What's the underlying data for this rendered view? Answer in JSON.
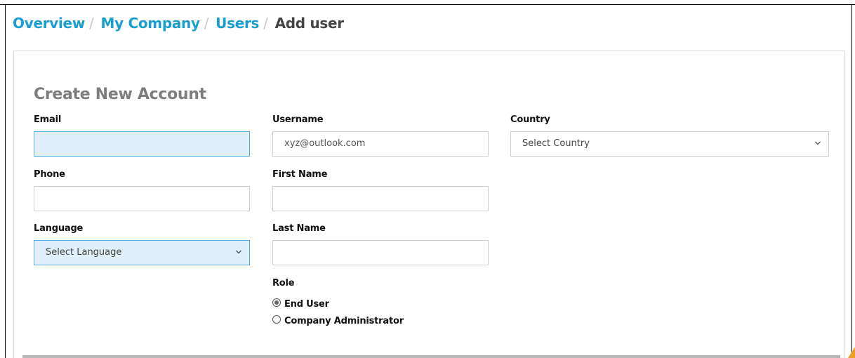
{
  "breadcrumb": {
    "items": [
      "Overview",
      "My Company",
      "Users"
    ],
    "separator": "/",
    "current": "Add user"
  },
  "form": {
    "title": "Create New Account",
    "email": {
      "label": "Email",
      "value": "",
      "placeholder": ""
    },
    "username": {
      "label": "Username",
      "value": "xyz@outlook.com"
    },
    "country": {
      "label": "Country",
      "selected": "Select Country"
    },
    "phone": {
      "label": "Phone",
      "value": ""
    },
    "first_name": {
      "label": "First Name",
      "value": ""
    },
    "language": {
      "label": "Language",
      "selected": "Select Language"
    },
    "last_name": {
      "label": "Last Name",
      "value": ""
    },
    "role": {
      "label": "Role",
      "options": [
        {
          "label": "End User",
          "checked": true
        },
        {
          "label": "Company Administrator",
          "checked": false
        }
      ]
    }
  },
  "colors": {
    "link": "#1a9ecf",
    "focus_bg": "#dff0fc",
    "focus_border": "#5aa9dd",
    "title_gray": "#7d7d7d"
  },
  "icons": [
    "chevron-down-icon",
    "radio-icon"
  ]
}
